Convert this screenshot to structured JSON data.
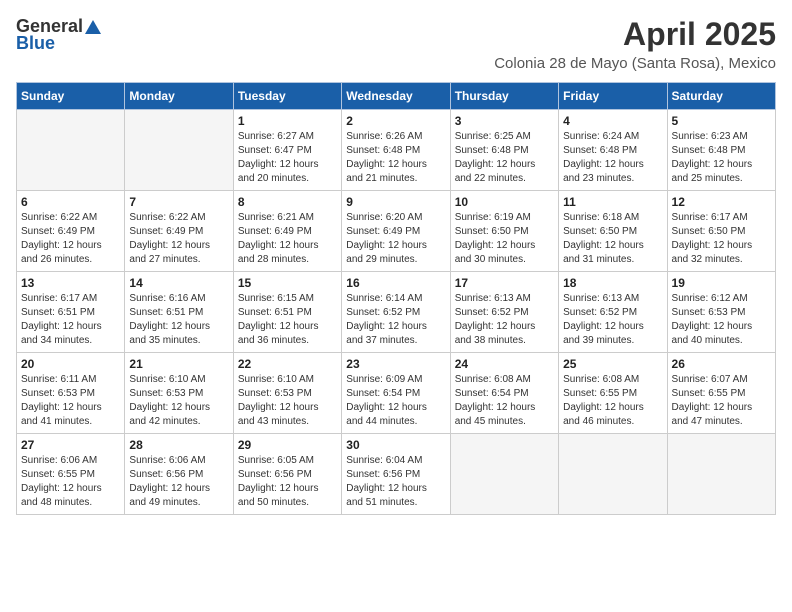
{
  "header": {
    "logo_general": "General",
    "logo_blue": "Blue",
    "month_title": "April 2025",
    "location": "Colonia 28 de Mayo (Santa Rosa), Mexico"
  },
  "days_of_week": [
    "Sunday",
    "Monday",
    "Tuesday",
    "Wednesday",
    "Thursday",
    "Friday",
    "Saturday"
  ],
  "weeks": [
    [
      {
        "day": "",
        "info": ""
      },
      {
        "day": "",
        "info": ""
      },
      {
        "day": "1",
        "info": "Sunrise: 6:27 AM\nSunset: 6:47 PM\nDaylight: 12 hours and 20 minutes."
      },
      {
        "day": "2",
        "info": "Sunrise: 6:26 AM\nSunset: 6:48 PM\nDaylight: 12 hours and 21 minutes."
      },
      {
        "day": "3",
        "info": "Sunrise: 6:25 AM\nSunset: 6:48 PM\nDaylight: 12 hours and 22 minutes."
      },
      {
        "day": "4",
        "info": "Sunrise: 6:24 AM\nSunset: 6:48 PM\nDaylight: 12 hours and 23 minutes."
      },
      {
        "day": "5",
        "info": "Sunrise: 6:23 AM\nSunset: 6:48 PM\nDaylight: 12 hours and 25 minutes."
      }
    ],
    [
      {
        "day": "6",
        "info": "Sunrise: 6:22 AM\nSunset: 6:49 PM\nDaylight: 12 hours and 26 minutes."
      },
      {
        "day": "7",
        "info": "Sunrise: 6:22 AM\nSunset: 6:49 PM\nDaylight: 12 hours and 27 minutes."
      },
      {
        "day": "8",
        "info": "Sunrise: 6:21 AM\nSunset: 6:49 PM\nDaylight: 12 hours and 28 minutes."
      },
      {
        "day": "9",
        "info": "Sunrise: 6:20 AM\nSunset: 6:49 PM\nDaylight: 12 hours and 29 minutes."
      },
      {
        "day": "10",
        "info": "Sunrise: 6:19 AM\nSunset: 6:50 PM\nDaylight: 12 hours and 30 minutes."
      },
      {
        "day": "11",
        "info": "Sunrise: 6:18 AM\nSunset: 6:50 PM\nDaylight: 12 hours and 31 minutes."
      },
      {
        "day": "12",
        "info": "Sunrise: 6:17 AM\nSunset: 6:50 PM\nDaylight: 12 hours and 32 minutes."
      }
    ],
    [
      {
        "day": "13",
        "info": "Sunrise: 6:17 AM\nSunset: 6:51 PM\nDaylight: 12 hours and 34 minutes."
      },
      {
        "day": "14",
        "info": "Sunrise: 6:16 AM\nSunset: 6:51 PM\nDaylight: 12 hours and 35 minutes."
      },
      {
        "day": "15",
        "info": "Sunrise: 6:15 AM\nSunset: 6:51 PM\nDaylight: 12 hours and 36 minutes."
      },
      {
        "day": "16",
        "info": "Sunrise: 6:14 AM\nSunset: 6:52 PM\nDaylight: 12 hours and 37 minutes."
      },
      {
        "day": "17",
        "info": "Sunrise: 6:13 AM\nSunset: 6:52 PM\nDaylight: 12 hours and 38 minutes."
      },
      {
        "day": "18",
        "info": "Sunrise: 6:13 AM\nSunset: 6:52 PM\nDaylight: 12 hours and 39 minutes."
      },
      {
        "day": "19",
        "info": "Sunrise: 6:12 AM\nSunset: 6:53 PM\nDaylight: 12 hours and 40 minutes."
      }
    ],
    [
      {
        "day": "20",
        "info": "Sunrise: 6:11 AM\nSunset: 6:53 PM\nDaylight: 12 hours and 41 minutes."
      },
      {
        "day": "21",
        "info": "Sunrise: 6:10 AM\nSunset: 6:53 PM\nDaylight: 12 hours and 42 minutes."
      },
      {
        "day": "22",
        "info": "Sunrise: 6:10 AM\nSunset: 6:53 PM\nDaylight: 12 hours and 43 minutes."
      },
      {
        "day": "23",
        "info": "Sunrise: 6:09 AM\nSunset: 6:54 PM\nDaylight: 12 hours and 44 minutes."
      },
      {
        "day": "24",
        "info": "Sunrise: 6:08 AM\nSunset: 6:54 PM\nDaylight: 12 hours and 45 minutes."
      },
      {
        "day": "25",
        "info": "Sunrise: 6:08 AM\nSunset: 6:55 PM\nDaylight: 12 hours and 46 minutes."
      },
      {
        "day": "26",
        "info": "Sunrise: 6:07 AM\nSunset: 6:55 PM\nDaylight: 12 hours and 47 minutes."
      }
    ],
    [
      {
        "day": "27",
        "info": "Sunrise: 6:06 AM\nSunset: 6:55 PM\nDaylight: 12 hours and 48 minutes."
      },
      {
        "day": "28",
        "info": "Sunrise: 6:06 AM\nSunset: 6:56 PM\nDaylight: 12 hours and 49 minutes."
      },
      {
        "day": "29",
        "info": "Sunrise: 6:05 AM\nSunset: 6:56 PM\nDaylight: 12 hours and 50 minutes."
      },
      {
        "day": "30",
        "info": "Sunrise: 6:04 AM\nSunset: 6:56 PM\nDaylight: 12 hours and 51 minutes."
      },
      {
        "day": "",
        "info": ""
      },
      {
        "day": "",
        "info": ""
      },
      {
        "day": "",
        "info": ""
      }
    ]
  ]
}
